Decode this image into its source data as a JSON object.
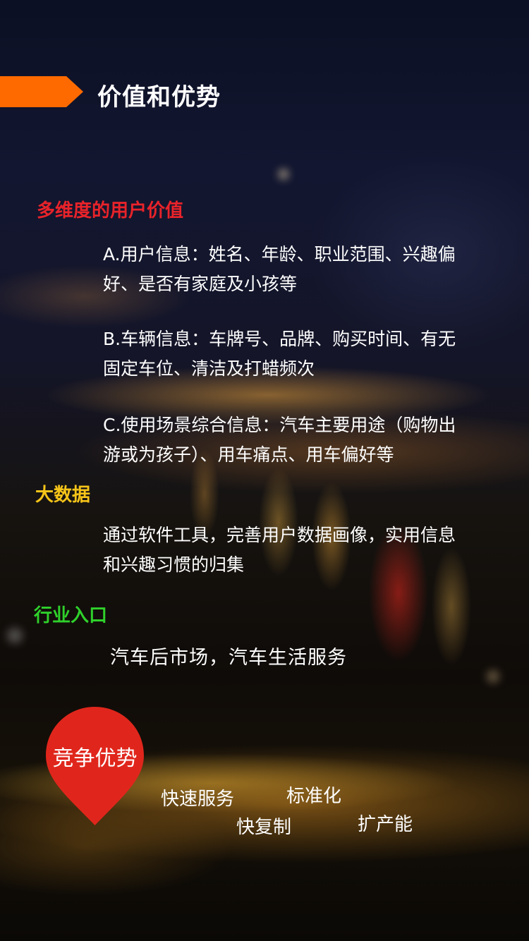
{
  "header": {
    "title": "价值和优势",
    "accent_color": "#ff6a00"
  },
  "sections": {
    "user_value": {
      "title": "多维度的用户价值",
      "color": "#e8232a",
      "items": [
        "A.用户信息：姓名、年龄、职业范围、兴趣偏好、是否有家庭及小孩等",
        "B.车辆信息：车牌号、品牌、购买时间、有无固定车位、清洁及打蜡频次",
        "C.使用场景综合信息：汽车主要用途（购物出游或为孩子）、用车痛点、用车偏好等"
      ]
    },
    "big_data": {
      "title": "大数据",
      "color": "#f6c419",
      "text": "通过软件工具，完善用户数据画像，实用信息和兴趣习惯的归集"
    },
    "industry_entry": {
      "title": "行业入口",
      "color": "#2fd12b",
      "text": "汽车后市场，汽车生活服务"
    }
  },
  "competitive_advantage": {
    "label": "竞争优势",
    "pin_color": "#e0261c",
    "items": [
      "快速服务",
      "标准化",
      "快复制",
      "扩产能"
    ]
  }
}
